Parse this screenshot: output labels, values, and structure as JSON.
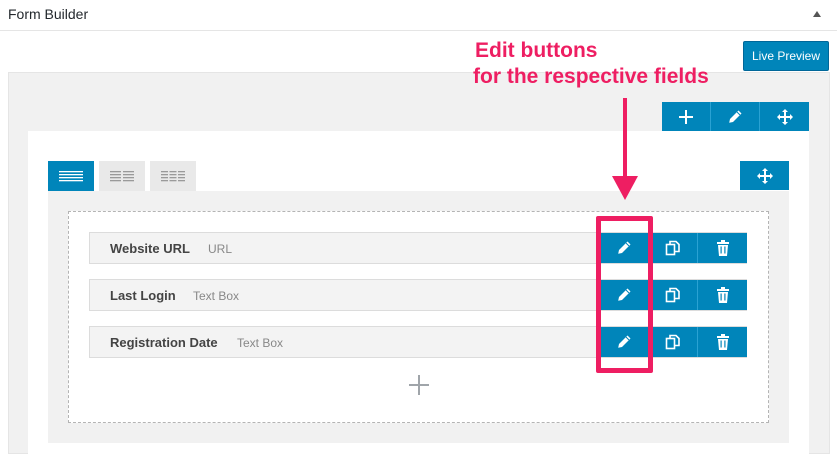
{
  "panel": {
    "title": "Form Builder"
  },
  "toolbar": {
    "live_preview_label": "Live Preview"
  },
  "annotation": {
    "line1": "Edit buttons",
    "line2": "for the respective fields"
  },
  "fields": [
    {
      "label": "Website URL",
      "type": "URL"
    },
    {
      "label": "Last Login",
      "type": "Text Box"
    },
    {
      "label": "Registration Date",
      "type": "Text Box"
    }
  ],
  "colors": {
    "accent": "#0085ba",
    "annotation": "#ee1e62"
  },
  "icons": {
    "section_toolbar": [
      "plus-icon",
      "pencil-icon",
      "move-icon"
    ],
    "tabs": [
      "one-column-layout-icon",
      "two-column-layout-icon",
      "three-column-layout-icon"
    ],
    "field_actions": [
      "pencil-icon",
      "duplicate-icon",
      "trash-icon"
    ]
  }
}
